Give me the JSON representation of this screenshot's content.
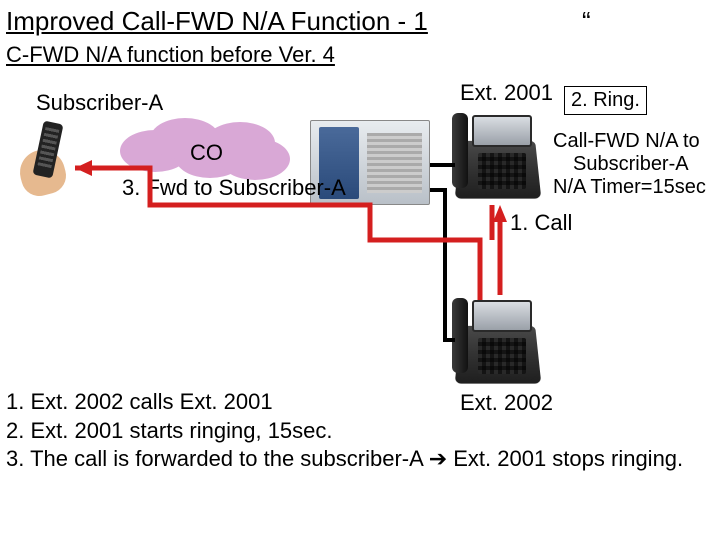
{
  "title": "Improved Call-FWD N/A Function - 1",
  "quote_mark": "“",
  "subtitle": "C-FWD N/A function before Ver. 4",
  "subscriber_label": "Subscriber-A",
  "co_label": "CO",
  "fwd_label": "3. Fwd to Subscriber-A",
  "ext2001_label": "Ext. 2001",
  "ring_box": "2. Ring.",
  "cfwd_info": {
    "line1": "Call-FWD N/A to",
    "line2": "Subscriber-A",
    "line3": "N/A Timer=15sec"
  },
  "call_label": "1. Call",
  "ext2002_label": "Ext. 2002",
  "steps": {
    "s1": "1. Ext. 2002 calls Ext. 2001",
    "s2": "2. Ext. 2001 starts ringing, 15sec.",
    "s3_a": "3. The call is forwarded to the subscriber-A ",
    "s3_arrow": "➔",
    "s3_b": " Ext. 2001 stops ringing."
  },
  "colors": {
    "red": "#d41f1f",
    "black": "#000000"
  }
}
